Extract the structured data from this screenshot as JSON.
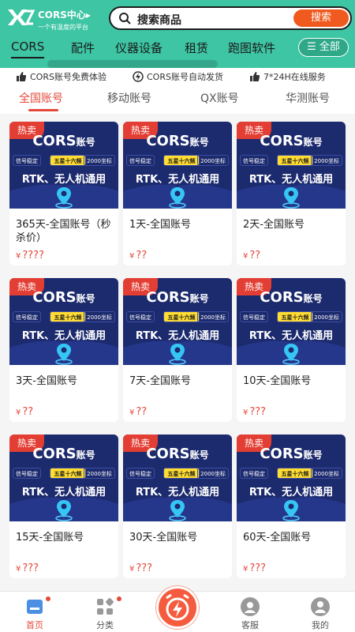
{
  "header": {
    "brand_name": "CORS中心▸",
    "brand_tagline": "一个有温度的平台",
    "search_placeholder": "搜索商品",
    "search_button": "搜索",
    "categories": [
      "CORS",
      "配件",
      "仪器设备",
      "租赁",
      "跑图软件"
    ],
    "all_button": "☰ 全部"
  },
  "benefits": [
    {
      "icon": "thumbs-up-icon",
      "text": "CORS账号免费体验"
    },
    {
      "icon": "lightning-icon",
      "text": "CORS账号自动发货"
    },
    {
      "icon": "thumbs-up-icon",
      "text": "7*24H在线服务"
    }
  ],
  "subtabs": [
    "全国账号",
    "移动账号",
    "QX账号",
    "华测账号"
  ],
  "banner": {
    "tag": "热卖",
    "title": "CORS",
    "title_suffix": "账号",
    "chip_left": "信号稳定",
    "chip_mid": "五星十六频",
    "chip_right": "2000坐标",
    "subtitle": "RTK、无人机通用"
  },
  "products": [
    {
      "name": "365天-全国账号（秒杀价）",
      "price": "????"
    },
    {
      "name": "1天-全国账号",
      "price": "??"
    },
    {
      "name": "2天-全国账号",
      "price": "??"
    },
    {
      "name": "3天-全国账号",
      "price": "??"
    },
    {
      "name": "7天-全国账号",
      "price": "??"
    },
    {
      "name": "10天-全国账号",
      "price": "???"
    },
    {
      "name": "15天-全国账号",
      "price": "???"
    },
    {
      "name": "30天-全国账号",
      "price": "???"
    },
    {
      "name": "60天-全国账号",
      "price": "???"
    }
  ],
  "currency": "¥",
  "bottom_nav": [
    {
      "label": "首页",
      "icon": "home-icon"
    },
    {
      "label": "分类",
      "icon": "category-icon"
    },
    {
      "label": "",
      "icon": "lightning-alarm-icon"
    },
    {
      "label": "客服",
      "icon": "customer-service-icon"
    },
    {
      "label": "我的",
      "icon": "user-icon"
    }
  ],
  "colors": {
    "brand": "#3ec5a4",
    "accent": "#e3493b",
    "banner": "#1c2a6e",
    "search_button": "#f05a1e"
  }
}
